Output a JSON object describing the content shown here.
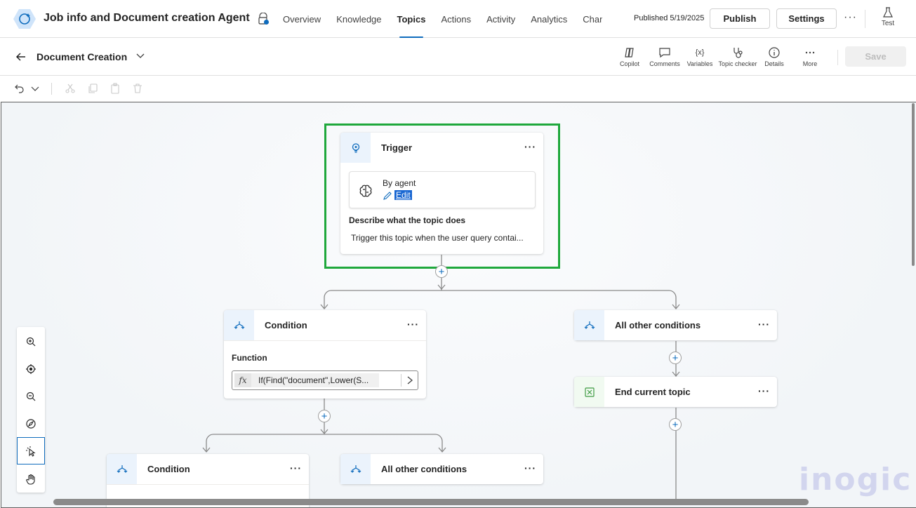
{
  "header": {
    "app_title": "Job info and Document creation Agent",
    "nav_tabs": [
      "Overview",
      "Knowledge",
      "Topics",
      "Actions",
      "Activity",
      "Analytics",
      "Channe"
    ],
    "active_tab": "Topics",
    "published_text": "Published 5/19/2025",
    "publish_label": "Publish",
    "settings_label": "Settings",
    "more_label": "···",
    "test_label": "Test"
  },
  "subbar": {
    "topic_name": "Document Creation",
    "tools": {
      "copilot": "Copilot",
      "comments": "Comments",
      "variables": "Variables",
      "topic_checker": "Topic checker",
      "details": "Details",
      "more": "More"
    },
    "save_label": "Save"
  },
  "canvas": {
    "trigger": {
      "title": "Trigger",
      "by_label": "By agent",
      "edit_label": "Edit",
      "describe_label": "Describe what the topic does",
      "description": "Trigger this topic when the user query contai..."
    },
    "condition_1": {
      "title": "Condition",
      "function_label": "Function",
      "formula": "If(Find(\"document\",Lower(S..."
    },
    "other_conditions_1": {
      "title": "All other conditions"
    },
    "end_topic": {
      "title": "End current topic"
    },
    "condition_2": {
      "title": "Condition"
    },
    "other_conditions_2": {
      "title": "All other conditions"
    },
    "more_glyph": "···",
    "plus_glyph": "+",
    "watermark": "inogic"
  },
  "colors": {
    "accent": "#0f6cbd",
    "highlight": "#1fa83c",
    "node_icon_bg": "#ebf3fc"
  }
}
